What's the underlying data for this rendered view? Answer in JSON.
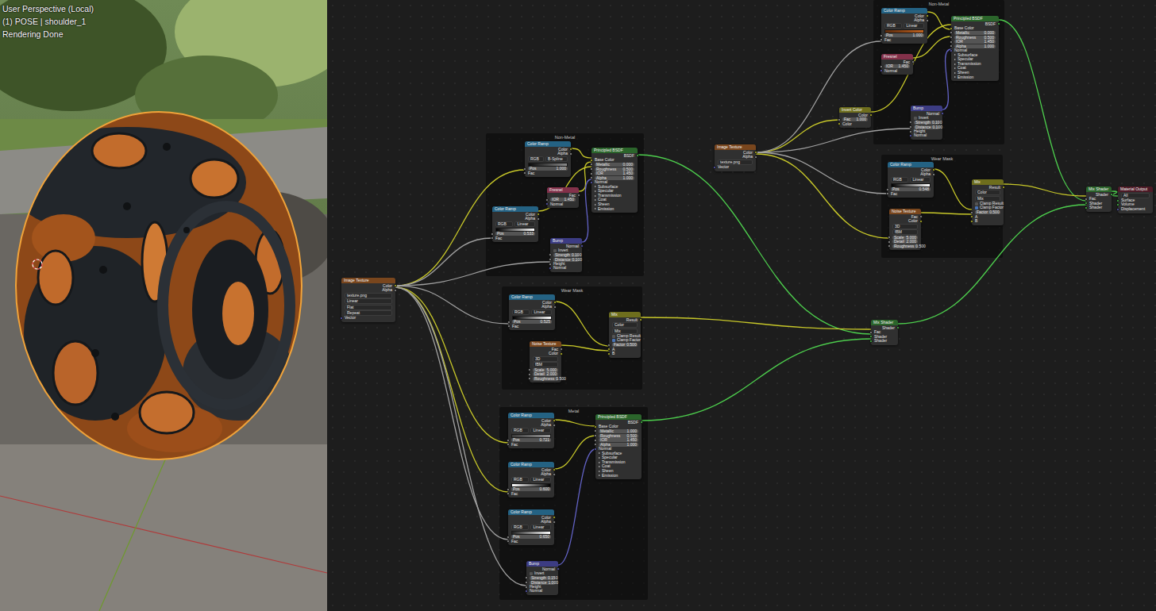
{
  "viewport": {
    "overlay": [
      "User Perspective (Local)",
      "(1) POSE | shoulder_1",
      "Rendering Done"
    ]
  },
  "node_editor": {
    "frames": [
      {
        "label": "Non-Metal"
      },
      {
        "label": "Wear Mask"
      },
      {
        "label": "Metal"
      },
      {
        "label": "Non-Metal"
      },
      {
        "label": "Wear Mask"
      }
    ],
    "nodes": [
      {
        "title": "Image Texture",
        "kind": "texture",
        "rows": [
          {
            "kind": "out",
            "text": "Color"
          },
          {
            "kind": "out",
            "text": "Alpha"
          },
          {
            "kind": "prop",
            "text": "texture.png"
          },
          {
            "kind": "prop",
            "text": "Linear"
          },
          {
            "kind": "prop",
            "text": "Flat"
          },
          {
            "kind": "prop",
            "text": "Repeat"
          },
          {
            "kind": "in",
            "text": "Vector"
          }
        ]
      },
      {
        "title": "Color Ramp",
        "kind": "converter",
        "rows": [
          {
            "kind": "out",
            "text": "Color"
          },
          {
            "kind": "out",
            "text": "Alpha"
          },
          {
            "kind": "pair",
            "text": "RGB",
            "value": "B-Spline"
          },
          {
            "kind": "ramp",
            "colors": [
              "#0b0b0b",
              "#8a8a8a"
            ]
          },
          {
            "kind": "field",
            "text": "Pos",
            "value": "1.000"
          },
          {
            "kind": "in",
            "text": "Fac"
          }
        ]
      },
      {
        "title": "Principled BSDF",
        "kind": "shader",
        "rows": [
          {
            "kind": "out",
            "text": "BSDF"
          },
          {
            "kind": "in",
            "text": "Base Color"
          },
          {
            "kind": "field",
            "text": "Metallic",
            "value": "0.000"
          },
          {
            "kind": "field",
            "text": "Roughness",
            "value": "0.500"
          },
          {
            "kind": "field",
            "text": "IOR",
            "value": "1.450"
          },
          {
            "kind": "field",
            "text": "Alpha",
            "value": "1.000"
          },
          {
            "kind": "in",
            "text": "Normal"
          },
          {
            "kind": "panel",
            "text": "Subsurface"
          },
          {
            "kind": "panel",
            "text": "Specular"
          },
          {
            "kind": "panel",
            "text": "Transmission"
          },
          {
            "kind": "panel",
            "text": "Coat"
          },
          {
            "kind": "panel",
            "text": "Sheen"
          },
          {
            "kind": "panel",
            "text": "Emission"
          }
        ]
      },
      {
        "title": "Fresnel",
        "kind": "input",
        "rows": [
          {
            "kind": "out",
            "text": "Fac"
          },
          {
            "kind": "field",
            "text": "IOR",
            "value": "1.450"
          },
          {
            "kind": "in",
            "text": "Normal"
          }
        ]
      },
      {
        "title": "Color Ramp",
        "kind": "converter",
        "rows": [
          {
            "kind": "out",
            "text": "Color"
          },
          {
            "kind": "out",
            "text": "Alpha"
          },
          {
            "kind": "pair",
            "text": "RGB",
            "value": "Linear"
          },
          {
            "kind": "ramp",
            "colors": [
              "#000000",
              "#ffffff"
            ]
          },
          {
            "kind": "field",
            "text": "Pos",
            "value": "0.533"
          },
          {
            "kind": "in",
            "text": "Fac"
          }
        ]
      },
      {
        "title": "Bump",
        "kind": "vector",
        "rows": [
          {
            "kind": "out",
            "text": "Normal"
          },
          {
            "kind": "check",
            "text": "Invert",
            "checked": false
          },
          {
            "kind": "field",
            "text": "Strength",
            "value": "0.100"
          },
          {
            "kind": "field",
            "text": "Distance",
            "value": "0.100"
          },
          {
            "kind": "in",
            "text": "Height"
          },
          {
            "kind": "in",
            "text": "Normal"
          }
        ]
      },
      {
        "title": "Color Ramp",
        "kind": "converter",
        "rows": [
          {
            "kind": "out",
            "text": "Color"
          },
          {
            "kind": "out",
            "text": "Alpha"
          },
          {
            "kind": "pair",
            "text": "RGB",
            "value": "Linear"
          },
          {
            "kind": "ramp",
            "colors": [
              "#000000",
              "#ffffff"
            ]
          },
          {
            "kind": "field",
            "text": "Pos",
            "value": "0.525"
          },
          {
            "kind": "in",
            "text": "Fac"
          }
        ]
      },
      {
        "title": "Mix",
        "kind": "color",
        "rows": [
          {
            "kind": "out",
            "text": "Result"
          },
          {
            "kind": "prop",
            "text": "Color"
          },
          {
            "kind": "prop",
            "text": "Mix"
          },
          {
            "kind": "check",
            "text": "Clamp Result",
            "checked": false
          },
          {
            "kind": "check",
            "text": "Clamp Factor",
            "checked": true
          },
          {
            "kind": "field",
            "text": "Factor",
            "value": "0.500"
          },
          {
            "kind": "in",
            "text": "A"
          },
          {
            "kind": "in",
            "text": "B"
          }
        ]
      },
      {
        "title": "Noise Texture",
        "kind": "texture",
        "rows": [
          {
            "kind": "out",
            "text": "Fac"
          },
          {
            "kind": "out",
            "text": "Color"
          },
          {
            "kind": "prop",
            "text": "3D"
          },
          {
            "kind": "prop",
            "text": "fBM"
          },
          {
            "kind": "field",
            "text": "Scale",
            "value": "5.000"
          },
          {
            "kind": "field",
            "text": "Detail",
            "value": "2.000"
          },
          {
            "kind": "field",
            "text": "Roughness",
            "value": "0.500"
          }
        ]
      },
      {
        "title": "Color Ramp",
        "kind": "converter",
        "rows": [
          {
            "kind": "out",
            "text": "Color"
          },
          {
            "kind": "out",
            "text": "Alpha"
          },
          {
            "kind": "pair",
            "text": "RGB",
            "value": "Linear"
          },
          {
            "kind": "ramp",
            "colors": [
              "#3a3a3a",
              "#9a9a9a"
            ]
          },
          {
            "kind": "field",
            "text": "Pos",
            "value": "0.721"
          },
          {
            "kind": "in",
            "text": "Fac"
          }
        ]
      },
      {
        "title": "Color Ramp",
        "kind": "converter",
        "rows": [
          {
            "kind": "out",
            "text": "Color"
          },
          {
            "kind": "out",
            "text": "Alpha"
          },
          {
            "kind": "pair",
            "text": "RGB",
            "value": "Linear"
          },
          {
            "kind": "ramp",
            "colors": [
              "#ffffff",
              "#000000"
            ]
          },
          {
            "kind": "field",
            "text": "Pos",
            "value": "0.600"
          },
          {
            "kind": "in",
            "text": "Fac"
          }
        ]
      },
      {
        "title": "Color Ramp",
        "kind": "converter",
        "rows": [
          {
            "kind": "out",
            "text": "Color"
          },
          {
            "kind": "out",
            "text": "Alpha"
          },
          {
            "kind": "pair",
            "text": "RGB",
            "value": "Linear"
          },
          {
            "kind": "ramp",
            "colors": [
              "#202020",
              "#ffffff"
            ]
          },
          {
            "kind": "field",
            "text": "Pos",
            "value": "0.650"
          },
          {
            "kind": "in",
            "text": "Fac"
          }
        ]
      },
      {
        "title": "Bump",
        "kind": "vector",
        "rows": [
          {
            "kind": "out",
            "text": "Normal"
          },
          {
            "kind": "check",
            "text": "Invert",
            "checked": false
          },
          {
            "kind": "field",
            "text": "Strength",
            "value": "0.150"
          },
          {
            "kind": "field",
            "text": "Distance",
            "value": "1.000"
          },
          {
            "kind": "in",
            "text": "Height"
          },
          {
            "kind": "in",
            "text": "Normal"
          }
        ]
      },
      {
        "title": "Principled BSDF",
        "kind": "shader",
        "rows": [
          {
            "kind": "out",
            "text": "BSDF"
          },
          {
            "kind": "in",
            "text": "Base Color"
          },
          {
            "kind": "field",
            "text": "Metallic",
            "value": "1.000"
          },
          {
            "kind": "field",
            "text": "Roughness",
            "value": "0.500"
          },
          {
            "kind": "field",
            "text": "IOR",
            "value": "1.450"
          },
          {
            "kind": "field",
            "text": "Alpha",
            "value": "1.000"
          },
          {
            "kind": "in",
            "text": "Normal"
          },
          {
            "kind": "panel",
            "text": "Subsurface"
          },
          {
            "kind": "panel",
            "text": "Specular"
          },
          {
            "kind": "panel",
            "text": "Transmission"
          },
          {
            "kind": "panel",
            "text": "Coat"
          },
          {
            "kind": "panel",
            "text": "Sheen"
          },
          {
            "kind": "panel",
            "text": "Emission"
          }
        ]
      },
      {
        "title": "Image Texture",
        "kind": "texture",
        "rows": [
          {
            "kind": "out",
            "text": "Color"
          },
          {
            "kind": "out",
            "text": "Alpha"
          },
          {
            "kind": "prop",
            "text": "texture.png"
          },
          {
            "kind": "in",
            "text": "Vector"
          }
        ]
      },
      {
        "title": "Invert Color",
        "kind": "color",
        "rows": [
          {
            "kind": "out",
            "text": "Color"
          },
          {
            "kind": "field",
            "text": "Fac",
            "value": "1.000"
          },
          {
            "kind": "in",
            "text": "Color"
          }
        ]
      },
      {
        "title": "Color Ramp",
        "kind": "converter",
        "rows": [
          {
            "kind": "out",
            "text": "Color"
          },
          {
            "kind": "out",
            "text": "Alpha"
          },
          {
            "kind": "pair",
            "text": "RGB",
            "value": "Linear"
          },
          {
            "kind": "ramp",
            "colors": [
              "#5a2a0c",
              "#c0621f"
            ]
          },
          {
            "kind": "field",
            "text": "Pos",
            "value": "1.000"
          },
          {
            "kind": "in",
            "text": "Fac"
          }
        ]
      },
      {
        "title": "Principled BSDF",
        "kind": "shader",
        "rows": [
          {
            "kind": "out",
            "text": "BSDF"
          },
          {
            "kind": "in",
            "text": "Base Color"
          },
          {
            "kind": "field",
            "text": "Metallic",
            "value": "0.000"
          },
          {
            "kind": "field",
            "text": "Roughness",
            "value": "0.500"
          },
          {
            "kind": "field",
            "text": "IOR",
            "value": "1.450"
          },
          {
            "kind": "field",
            "text": "Alpha",
            "value": "1.000"
          },
          {
            "kind": "in",
            "text": "Normal"
          },
          {
            "kind": "panel",
            "text": "Subsurface"
          },
          {
            "kind": "panel",
            "text": "Specular"
          },
          {
            "kind": "panel",
            "text": "Transmission"
          },
          {
            "kind": "panel",
            "text": "Coat"
          },
          {
            "kind": "panel",
            "text": "Sheen"
          },
          {
            "kind": "panel",
            "text": "Emission"
          }
        ]
      },
      {
        "title": "Fresnel",
        "kind": "input",
        "rows": [
          {
            "kind": "out",
            "text": "Fac"
          },
          {
            "kind": "field",
            "text": "IOR",
            "value": "1.450"
          },
          {
            "kind": "in",
            "text": "Normal"
          }
        ]
      },
      {
        "title": "Bump",
        "kind": "vector",
        "rows": [
          {
            "kind": "out",
            "text": "Normal"
          },
          {
            "kind": "check",
            "text": "Invert",
            "checked": false
          },
          {
            "kind": "field",
            "text": "Strength",
            "value": "0.100"
          },
          {
            "kind": "field",
            "text": "Distance",
            "value": "0.100"
          },
          {
            "kind": "in",
            "text": "Height"
          },
          {
            "kind": "in",
            "text": "Normal"
          }
        ]
      },
      {
        "title": "Color Ramp",
        "kind": "converter",
        "rows": [
          {
            "kind": "out",
            "text": "Color"
          },
          {
            "kind": "out",
            "text": "Alpha"
          },
          {
            "kind": "pair",
            "text": "RGB",
            "value": "Linear"
          },
          {
            "kind": "ramp",
            "colors": [
              "#000000",
              "#ffffff"
            ]
          },
          {
            "kind": "field",
            "text": "Pos",
            "value": "0.548"
          },
          {
            "kind": "in",
            "text": "Fac"
          }
        ]
      },
      {
        "title": "Mix",
        "kind": "color",
        "rows": [
          {
            "kind": "out",
            "text": "Result"
          },
          {
            "kind": "prop",
            "text": "Color"
          },
          {
            "kind": "prop",
            "text": "Mix"
          },
          {
            "kind": "check",
            "text": "Clamp Result",
            "checked": false
          },
          {
            "kind": "check",
            "text": "Clamp Factor",
            "checked": true
          },
          {
            "kind": "field",
            "text": "Factor",
            "value": "0.500"
          },
          {
            "kind": "in",
            "text": "A"
          },
          {
            "kind": "in",
            "text": "B"
          }
        ]
      },
      {
        "title": "Noise Texture",
        "kind": "texture",
        "rows": [
          {
            "kind": "out",
            "text": "Fac"
          },
          {
            "kind": "out",
            "text": "Color"
          },
          {
            "kind": "prop",
            "text": "3D"
          },
          {
            "kind": "prop",
            "text": "fBM"
          },
          {
            "kind": "field",
            "text": "Scale",
            "value": "5.000"
          },
          {
            "kind": "field",
            "text": "Detail",
            "value": "2.000"
          },
          {
            "kind": "field",
            "text": "Roughness",
            "value": "0.500"
          }
        ]
      },
      {
        "title": "Mix Shader",
        "kind": "shader",
        "rows": [
          {
            "kind": "out",
            "text": "Shader"
          },
          {
            "kind": "in",
            "text": "Fac"
          },
          {
            "kind": "in",
            "text": "Shader"
          },
          {
            "kind": "in",
            "text": "Shader"
          }
        ]
      },
      {
        "title": "Mix Shader",
        "kind": "shader",
        "rows": [
          {
            "kind": "out",
            "text": "Shader"
          },
          {
            "kind": "in",
            "text": "Fac"
          },
          {
            "kind": "in",
            "text": "Shader"
          },
          {
            "kind": "in",
            "text": "Shader"
          }
        ]
      },
      {
        "title": "Material Output",
        "kind": "output",
        "rows": [
          {
            "kind": "prop",
            "text": "All"
          },
          {
            "kind": "in",
            "text": "Surface"
          },
          {
            "kind": "in",
            "text": "Volume"
          },
          {
            "kind": "in",
            "text": "Displacement"
          }
        ]
      }
    ]
  }
}
